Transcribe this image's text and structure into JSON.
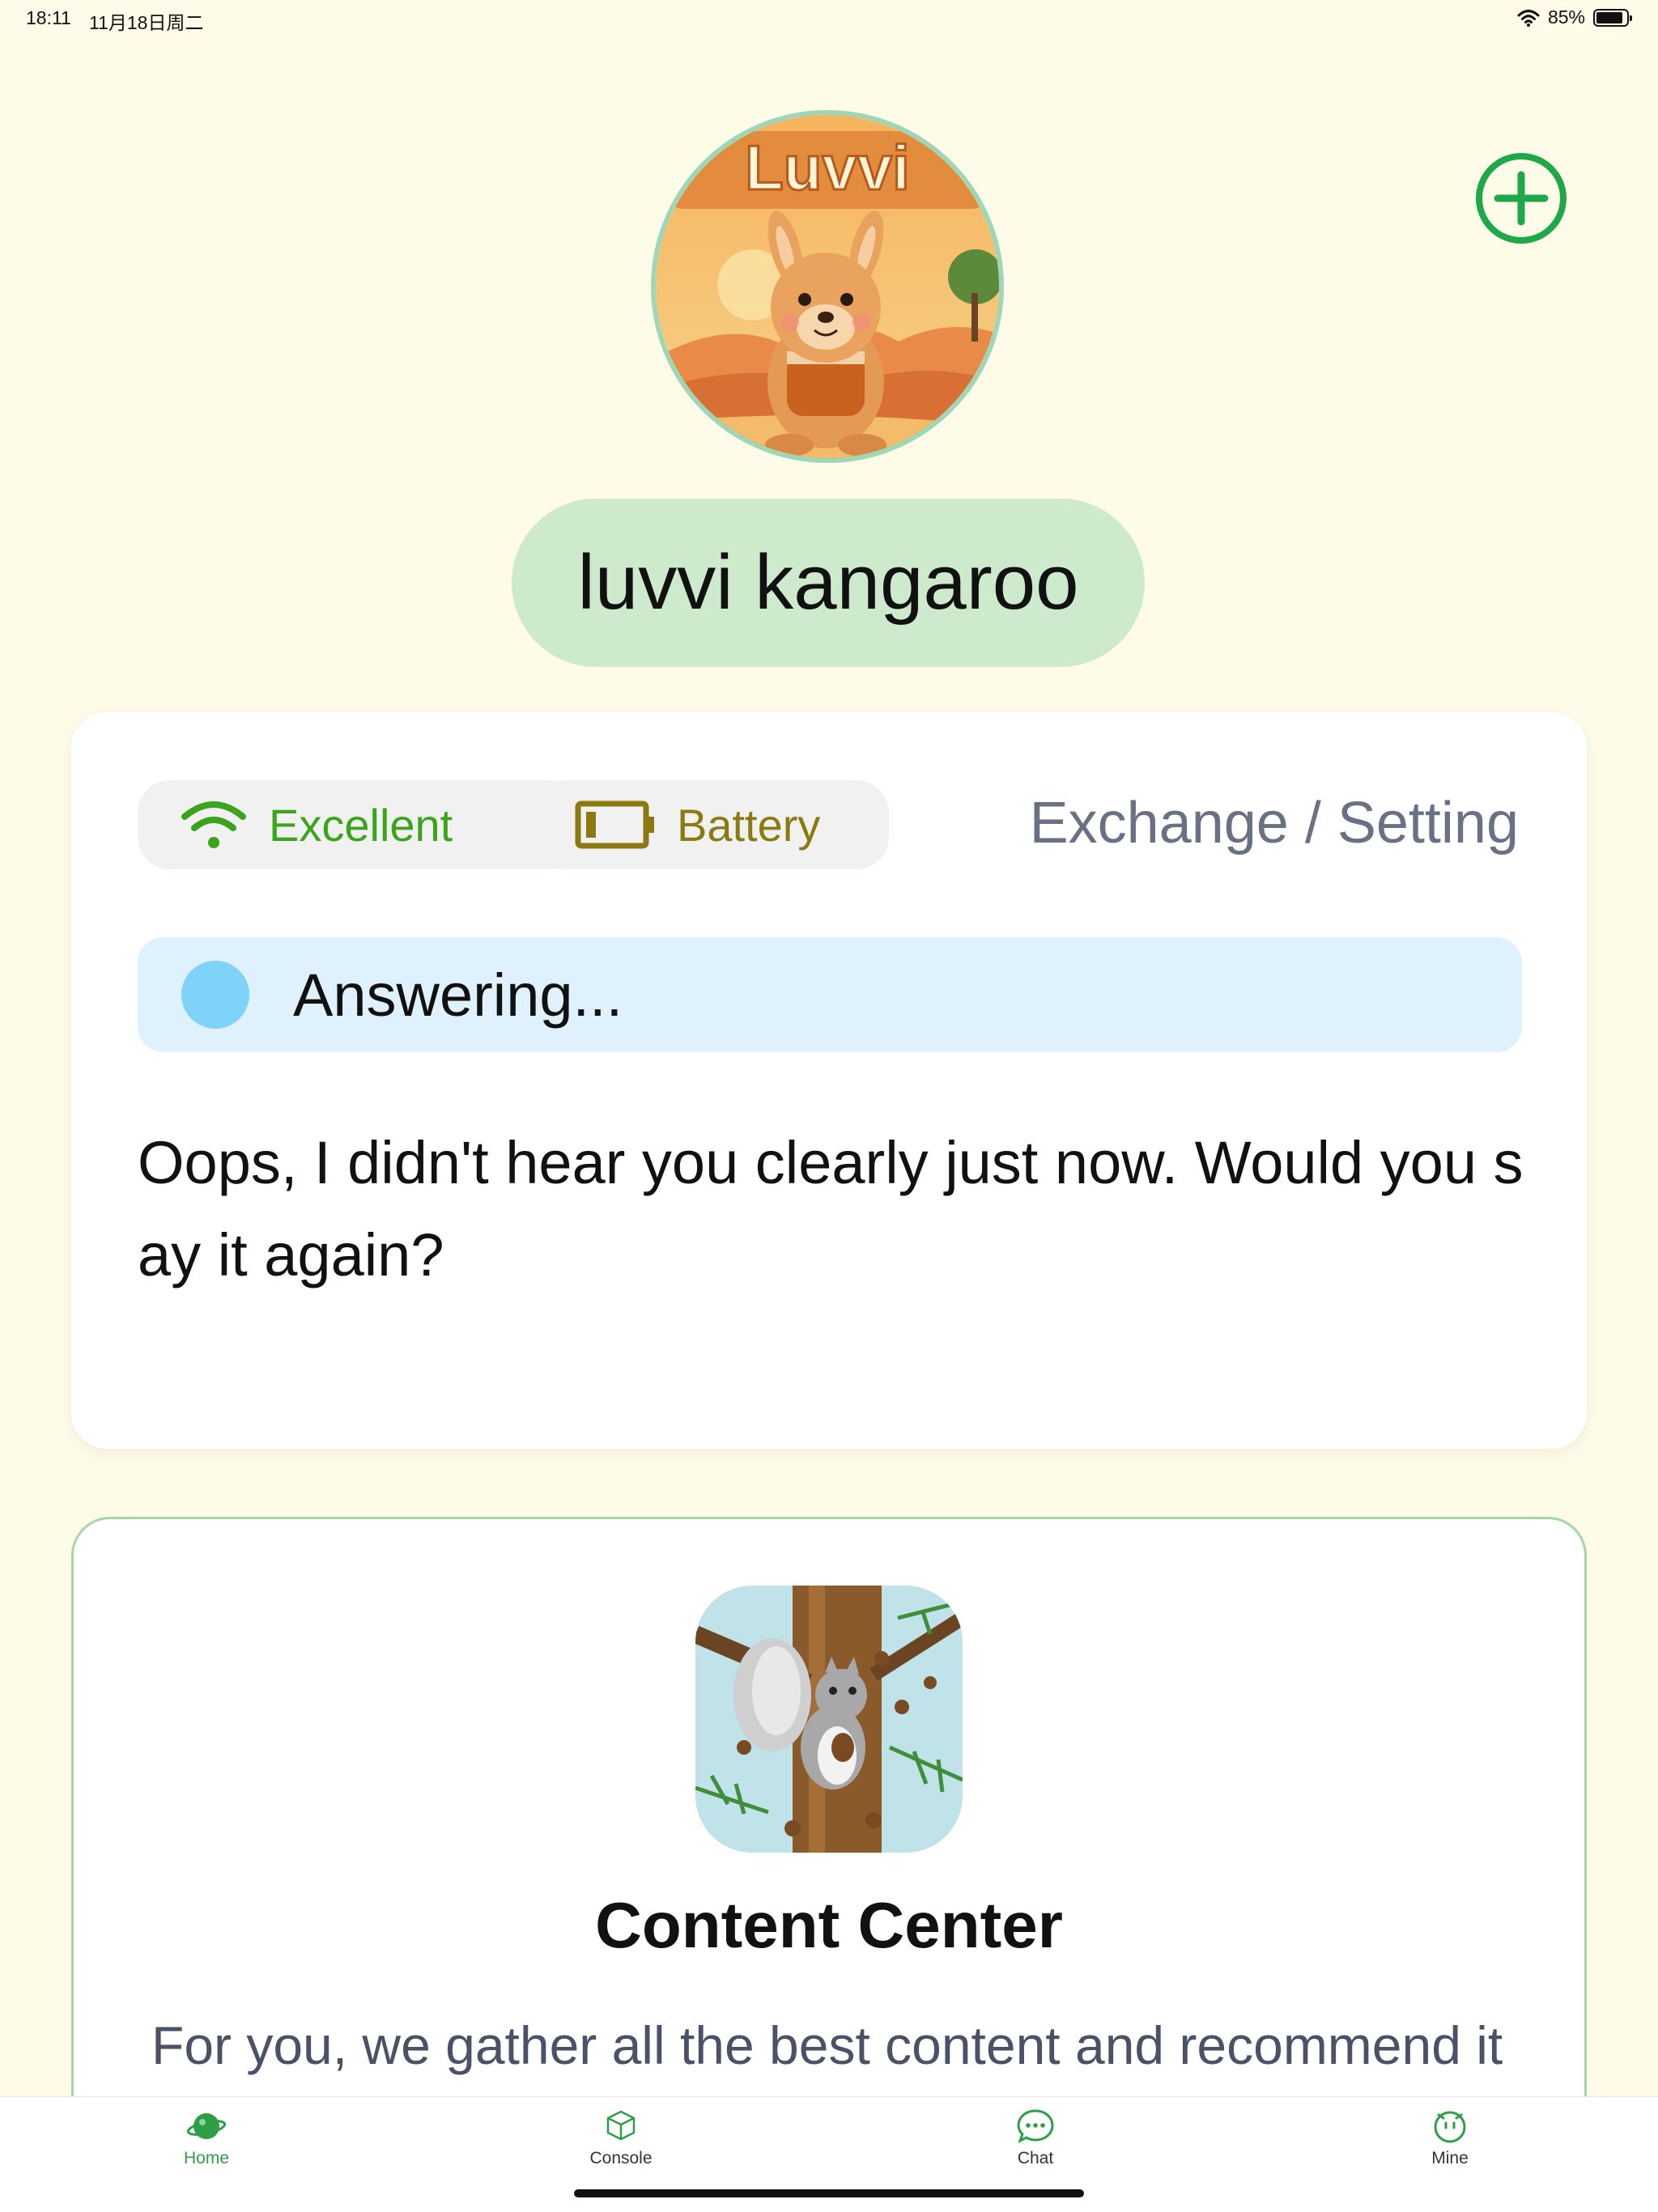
{
  "status_bar": {
    "time": "18:11",
    "date": "11月18日周二",
    "battery_percent": "85%"
  },
  "device": {
    "name": "luvvi kangaroo",
    "avatar_text": "Luvvi"
  },
  "connection": {
    "wifi_label": "Excellent",
    "battery_label": "Battery",
    "exchange_setting_label": "Exchange / Setting"
  },
  "dialog": {
    "status_text": "Answering...",
    "reply_text": "Oops, I didn't hear you clearly just now. Would you say it again?"
  },
  "content_center": {
    "title": "Content Center",
    "description": "For you, we gather all the best content and recommend it"
  },
  "tabs": [
    {
      "label": "Home",
      "icon": "home-planet-icon",
      "active": true
    },
    {
      "label": "Console",
      "icon": "cube-icon",
      "active": false
    },
    {
      "label": "Chat",
      "icon": "chat-bubble-icon",
      "active": false
    },
    {
      "label": "Mine",
      "icon": "face-icon",
      "active": false
    }
  ],
  "colors": {
    "background": "#fefbe8",
    "accent_green": "#1fa84a",
    "pill_green": "#cdeacd",
    "wifi_green": "#3aa51a",
    "battery_olive": "#8a7a10",
    "answer_blue": "#dff1fc",
    "answer_dot": "#7fd2f8"
  }
}
